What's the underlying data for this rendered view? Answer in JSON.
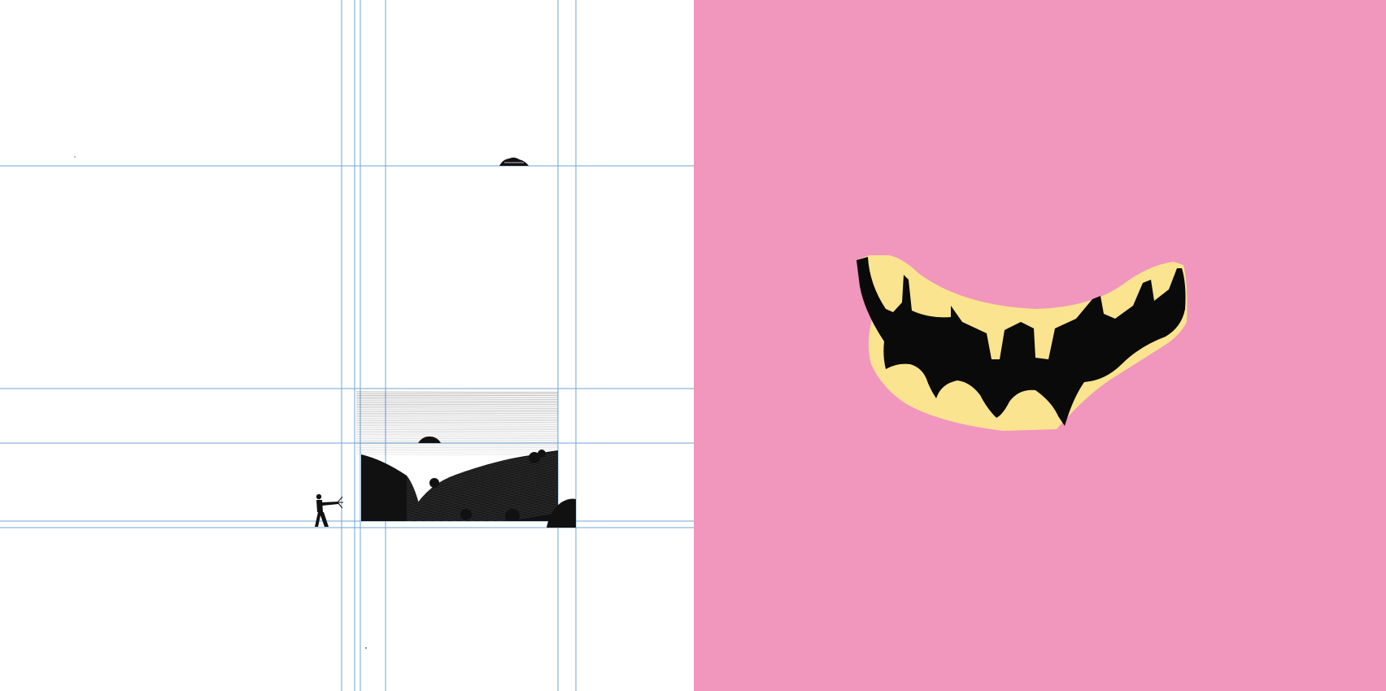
{
  "spread": {
    "left_page": {
      "guide_color": "#6fa6d6",
      "ink_color": "#111111",
      "paper_color": "#ffffff"
    },
    "right_page": {
      "background_color": "#f196bd",
      "mouth_color": "#0a0a0a",
      "teeth_color": "#fbe48f"
    }
  }
}
